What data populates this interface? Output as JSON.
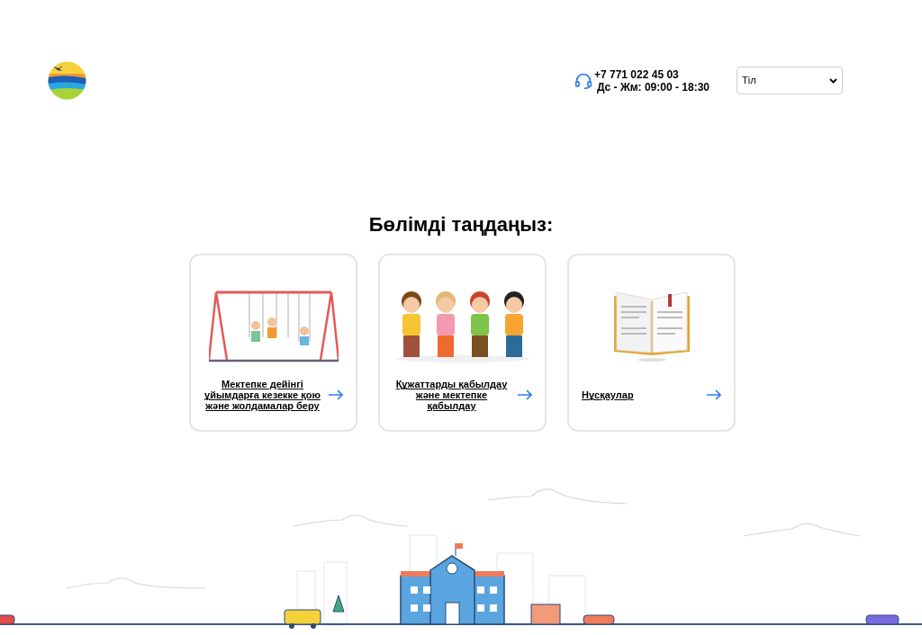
{
  "header": {
    "phone": "+7 771 022 45 03",
    "hours": "Дс - Жм: 09:00 - 18:30",
    "language_select": {
      "value": "Тіл"
    }
  },
  "title": "Бөлімді таңдаңыз:",
  "cards": [
    {
      "kind": "swings",
      "label": "Мектепке дейінгі ұйымдарға кезекке қою және жолдамалар беру"
    },
    {
      "kind": "children",
      "label": "Құжаттарды қабылдау және мектепке қабылдау"
    },
    {
      "kind": "book",
      "label": "Нұсқаулар"
    }
  ]
}
